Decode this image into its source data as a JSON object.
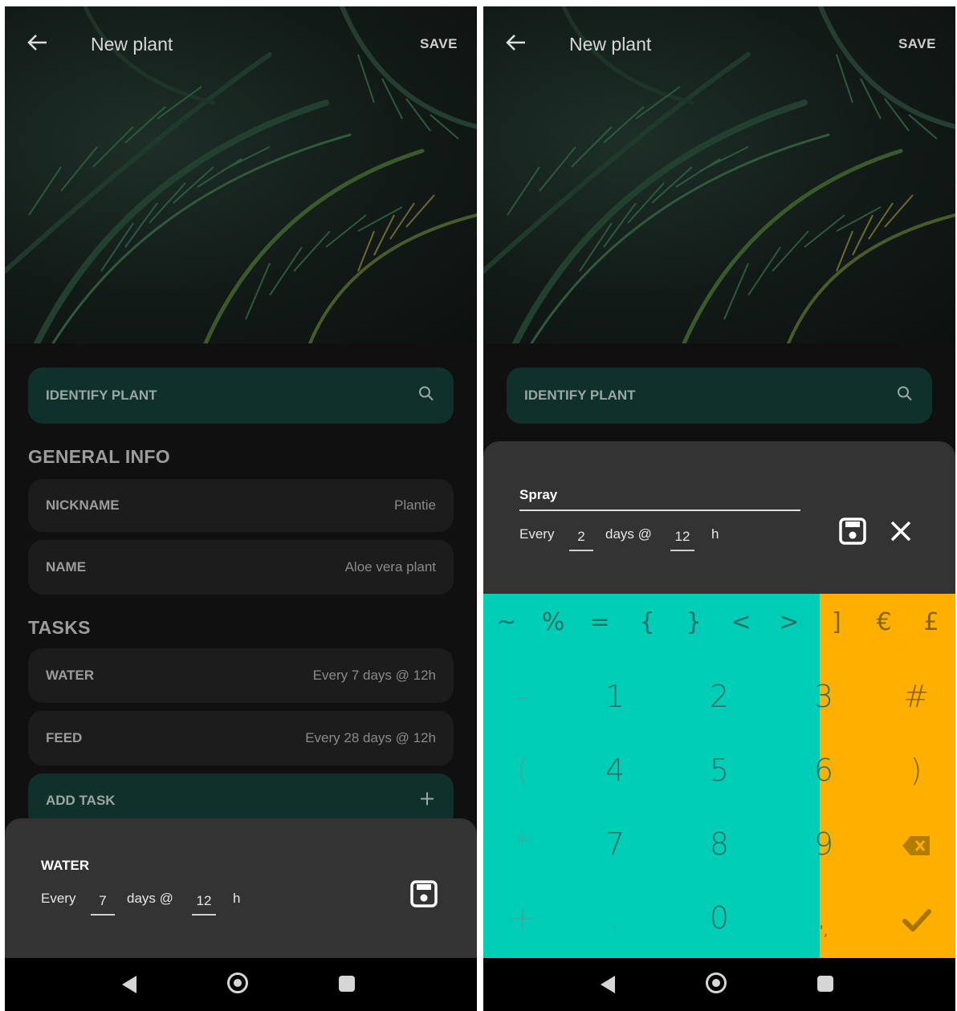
{
  "left": {
    "appbar": {
      "title": "New plant",
      "save": "SAVE"
    },
    "identify": {
      "label": "IDENTIFY PLANT"
    },
    "general": {
      "heading": "GENERAL INFO",
      "fields": [
        {
          "label": "NICKNAME",
          "value": "Plantie"
        },
        {
          "label": "NAME",
          "value": "Aloe vera plant"
        }
      ]
    },
    "tasks": {
      "heading": "TASKS",
      "items": [
        {
          "label": "WATER",
          "value": "Every 7 days @ 12h"
        },
        {
          "label": "FEED",
          "value": "Every 28 days @ 12h"
        }
      ],
      "add": "ADD TASK"
    },
    "sheet": {
      "title": "WATER",
      "every": "Every",
      "days_value": "7",
      "days_at": "days @",
      "hour_value": "12",
      "h": "h"
    }
  },
  "right": {
    "appbar": {
      "title": "New plant",
      "save": "SAVE"
    },
    "identify": {
      "label": "IDENTIFY PLANT"
    },
    "sheet": {
      "title": "Spray",
      "every": "Every",
      "days_value": "2",
      "days_at": "days @",
      "hour_value": "12",
      "h": "h"
    },
    "keyboard": {
      "row1": [
        "~",
        "%",
        "=",
        "{",
        "}",
        "<",
        ">",
        "]",
        "€",
        "£"
      ],
      "row2": [
        "-",
        "1",
        "2",
        "3",
        "#"
      ],
      "row3": [
        "(",
        "4",
        "5",
        "6",
        ")"
      ],
      "row4": [
        "*",
        "7",
        "8",
        "9"
      ],
      "row5": [
        "+",
        ".",
        "0",
        "',"
      ]
    }
  },
  "colors": {
    "teal_keys": "#00cdb5",
    "orange_keys": "#ffaf00",
    "card": "#1c1c1c",
    "teal_card": "#10302b",
    "sheet": "#333333"
  },
  "icons": [
    "back-arrow-icon",
    "search-icon",
    "plus-icon",
    "save-icon",
    "close-icon",
    "backspace-icon",
    "check-icon",
    "nav-back-icon",
    "nav-home-icon",
    "nav-recents-icon"
  ]
}
